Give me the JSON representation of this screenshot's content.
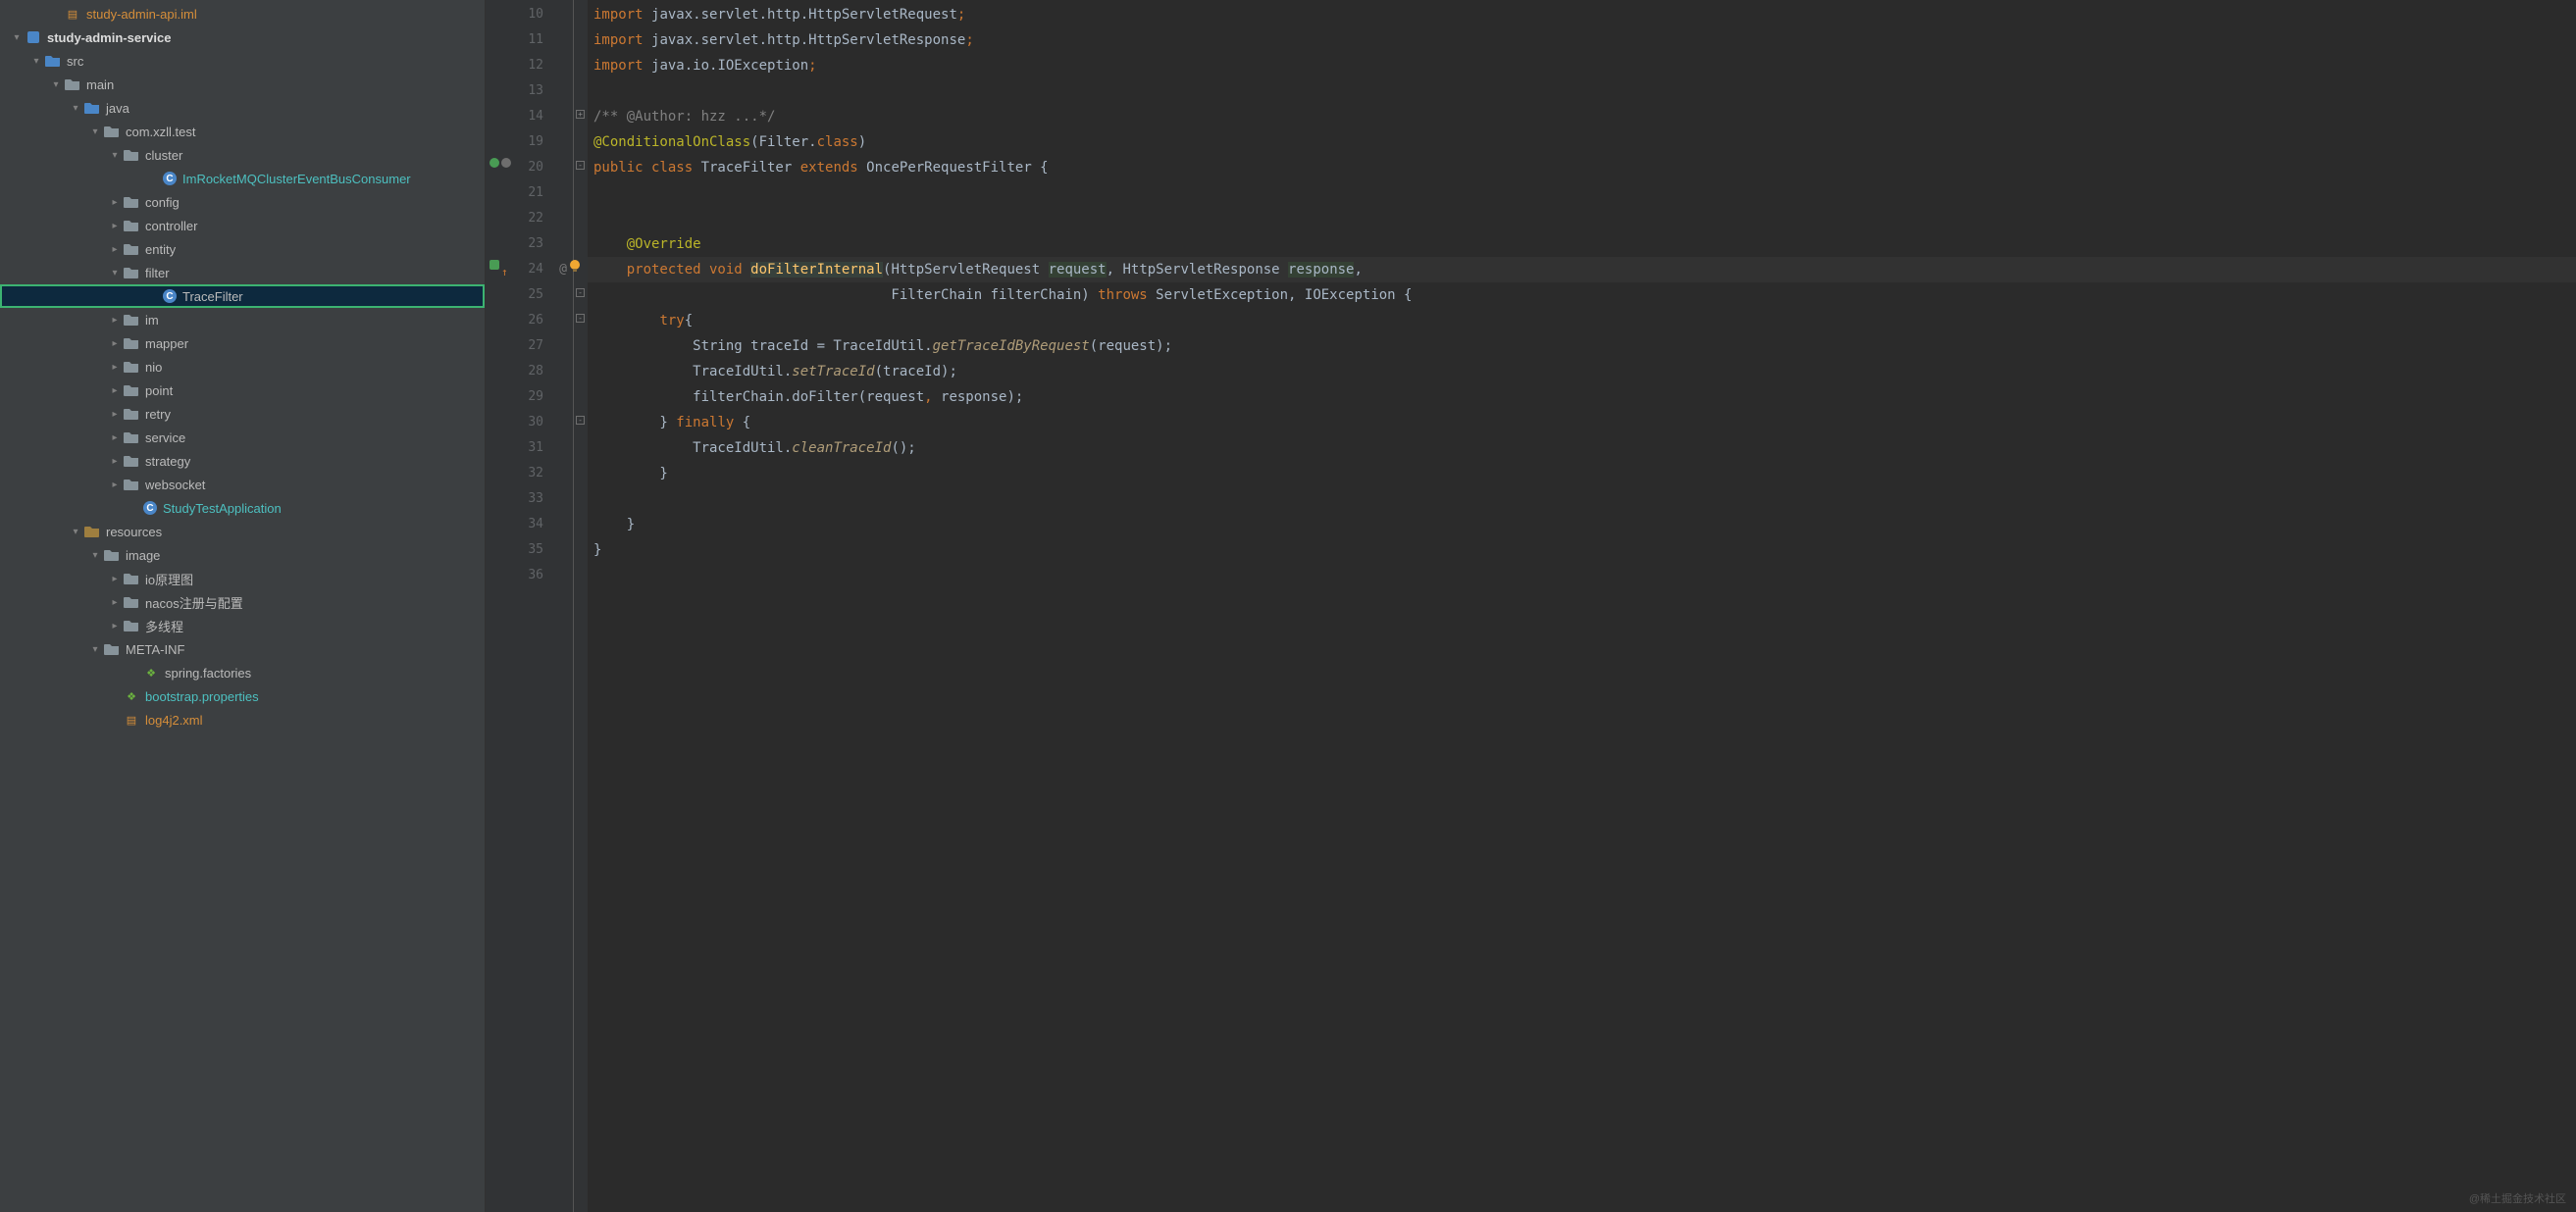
{
  "watermark": "@稀土掘金技术社区",
  "tree": [
    {
      "indent": 50,
      "arrow": "",
      "icon": "file-orange",
      "label": "study-admin-api.iml",
      "cls": "txt-orange"
    },
    {
      "indent": 10,
      "arrow": "▾",
      "icon": "module",
      "label": "study-admin-service",
      "bold": true
    },
    {
      "indent": 30,
      "arrow": "▾",
      "icon": "folder-blue",
      "label": "src"
    },
    {
      "indent": 50,
      "arrow": "▾",
      "icon": "folder",
      "label": "main"
    },
    {
      "indent": 70,
      "arrow": "▾",
      "icon": "folder-blue",
      "label": "java"
    },
    {
      "indent": 90,
      "arrow": "▾",
      "icon": "folder",
      "label": "com.xzll.test"
    },
    {
      "indent": 110,
      "arrow": "▾",
      "icon": "folder",
      "label": "cluster"
    },
    {
      "indent": 150,
      "arrow": "",
      "icon": "class",
      "label": "ImRocketMQClusterEventBusConsumer",
      "cls": "txt-highlight"
    },
    {
      "indent": 110,
      "arrow": "▸",
      "icon": "folder",
      "label": "config"
    },
    {
      "indent": 110,
      "arrow": "▸",
      "icon": "folder",
      "label": "controller"
    },
    {
      "indent": 110,
      "arrow": "▸",
      "icon": "folder",
      "label": "entity"
    },
    {
      "indent": 110,
      "arrow": "▾",
      "icon": "folder",
      "label": "filter"
    },
    {
      "indent": 150,
      "arrow": "",
      "icon": "class",
      "label": "TraceFilter",
      "selected": true,
      "highlighted": true
    },
    {
      "indent": 110,
      "arrow": "▸",
      "icon": "folder",
      "label": "im"
    },
    {
      "indent": 110,
      "arrow": "▸",
      "icon": "folder",
      "label": "mapper"
    },
    {
      "indent": 110,
      "arrow": "▸",
      "icon": "folder",
      "label": "nio"
    },
    {
      "indent": 110,
      "arrow": "▸",
      "icon": "folder",
      "label": "point"
    },
    {
      "indent": 110,
      "arrow": "▸",
      "icon": "folder",
      "label": "retry"
    },
    {
      "indent": 110,
      "arrow": "▸",
      "icon": "folder",
      "label": "service"
    },
    {
      "indent": 110,
      "arrow": "▸",
      "icon": "folder",
      "label": "strategy"
    },
    {
      "indent": 110,
      "arrow": "▸",
      "icon": "folder",
      "label": "websocket"
    },
    {
      "indent": 130,
      "arrow": "",
      "icon": "class",
      "label": "StudyTestApplication",
      "cls": "txt-highlight"
    },
    {
      "indent": 70,
      "arrow": "▾",
      "icon": "folder-yellow",
      "label": "resources"
    },
    {
      "indent": 90,
      "arrow": "▾",
      "icon": "folder",
      "label": "image"
    },
    {
      "indent": 110,
      "arrow": "▸",
      "icon": "folder",
      "label": "io原理图"
    },
    {
      "indent": 110,
      "arrow": "▸",
      "icon": "folder",
      "label": "nacos注册与配置"
    },
    {
      "indent": 110,
      "arrow": "▸",
      "icon": "folder",
      "label": "多线程"
    },
    {
      "indent": 90,
      "arrow": "▾",
      "icon": "folder",
      "label": "META-INF"
    },
    {
      "indent": 130,
      "arrow": "",
      "icon": "leaf-green",
      "label": "spring.factories"
    },
    {
      "indent": 110,
      "arrow": "",
      "icon": "leaf-green",
      "label": "bootstrap.properties",
      "cls": "txt-highlight"
    },
    {
      "indent": 110,
      "arrow": "",
      "icon": "file-orange",
      "label": "log4j2.xml",
      "cls": "txt-orange"
    }
  ],
  "gutter": {
    "start": 10,
    "lines": [
      {
        "n": 10
      },
      {
        "n": 11
      },
      {
        "n": 12
      },
      {
        "n": 13
      },
      {
        "n": 14
      },
      {
        "n": 19
      },
      {
        "n": 20,
        "marks": [
          "green-circle",
          "grey-circle"
        ]
      },
      {
        "n": 21
      },
      {
        "n": 22
      },
      {
        "n": 23
      },
      {
        "n": 24,
        "marks": [
          "override",
          "up-arrow"
        ],
        "at": "@"
      },
      {
        "n": 25
      },
      {
        "n": 26
      },
      {
        "n": 27
      },
      {
        "n": 28
      },
      {
        "n": 29
      },
      {
        "n": 30
      },
      {
        "n": 31
      },
      {
        "n": 32
      },
      {
        "n": 33
      },
      {
        "n": 34
      },
      {
        "n": 35
      },
      {
        "n": 36
      }
    ]
  },
  "code": [
    {
      "tokens": [
        [
          "kw",
          "import "
        ],
        [
          "pl",
          "javax.servlet.http.HttpServletRequest"
        ],
        [
          "kw",
          ";"
        ]
      ]
    },
    {
      "tokens": [
        [
          "kw",
          "import "
        ],
        [
          "pl",
          "javax.servlet.http.HttpServletResponse"
        ],
        [
          "kw",
          ";"
        ]
      ]
    },
    {
      "tokens": [
        [
          "kw",
          "import "
        ],
        [
          "pl",
          "java.io.IOException"
        ],
        [
          "kw",
          ";"
        ]
      ]
    },
    {
      "tokens": []
    },
    {
      "tokens": [
        [
          "com",
          "/** @Author: hzz ...*/"
        ]
      ]
    },
    {
      "tokens": [
        [
          "ann",
          "@ConditionalOnClass"
        ],
        [
          "pl",
          "(Filter."
        ],
        [
          "kw",
          "class"
        ],
        [
          "pl",
          ")"
        ]
      ]
    },
    {
      "tokens": [
        [
          "kw",
          "public class "
        ],
        [
          "typ",
          "TraceFilter "
        ],
        [
          "kw",
          "extends "
        ],
        [
          "typ",
          "OncePerRequestFilter {"
        ]
      ]
    },
    {
      "tokens": []
    },
    {
      "tokens": []
    },
    {
      "tokens": [
        [
          "pl",
          "    "
        ],
        [
          "ann",
          "@Override"
        ]
      ]
    },
    {
      "cursor": true,
      "bulb": true,
      "tokens": [
        [
          "pl",
          "    "
        ],
        [
          "kw",
          "protected void "
        ],
        [
          "fn sel",
          "doFilterInternal"
        ],
        [
          "pl",
          "(HttpServletRequest "
        ],
        [
          "pl hl",
          "request"
        ],
        [
          "pl",
          ", HttpServletResponse "
        ],
        [
          "pl hl",
          "response"
        ],
        [
          "pl",
          ","
        ]
      ]
    },
    {
      "tokens": [
        [
          "pl",
          "                                    FilterChain filterChain) "
        ],
        [
          "kw",
          "throws "
        ],
        [
          "typ",
          "ServletException"
        ],
        [
          "pl",
          ", "
        ],
        [
          "typ",
          "IOException {"
        ]
      ]
    },
    {
      "tokens": [
        [
          "pl",
          "        "
        ],
        [
          "kw",
          "try"
        ],
        [
          "pl",
          "{"
        ]
      ]
    },
    {
      "tokens": [
        [
          "pl",
          "            String traceId = TraceIdUtil."
        ],
        [
          "fni",
          "getTraceIdByRequest"
        ],
        [
          "pl",
          "(request);"
        ]
      ]
    },
    {
      "tokens": [
        [
          "pl",
          "            TraceIdUtil."
        ],
        [
          "fni",
          "setTraceId"
        ],
        [
          "pl",
          "(traceId);"
        ]
      ]
    },
    {
      "tokens": [
        [
          "pl",
          "            filterChain.doFilter(request"
        ],
        [
          "kw",
          ","
        ],
        [
          "pl",
          " response);"
        ]
      ]
    },
    {
      "tokens": [
        [
          "pl",
          "        } "
        ],
        [
          "kw",
          "finally"
        ],
        [
          "pl",
          " {"
        ]
      ]
    },
    {
      "tokens": [
        [
          "pl",
          "            TraceIdUtil."
        ],
        [
          "fni",
          "cleanTraceId"
        ],
        [
          "pl",
          "();"
        ]
      ]
    },
    {
      "tokens": [
        [
          "pl",
          "        }"
        ]
      ]
    },
    {
      "tokens": []
    },
    {
      "tokens": [
        [
          "pl",
          "    }"
        ]
      ]
    },
    {
      "tokens": [
        [
          "pl",
          "}"
        ]
      ]
    },
    {
      "tokens": []
    }
  ]
}
